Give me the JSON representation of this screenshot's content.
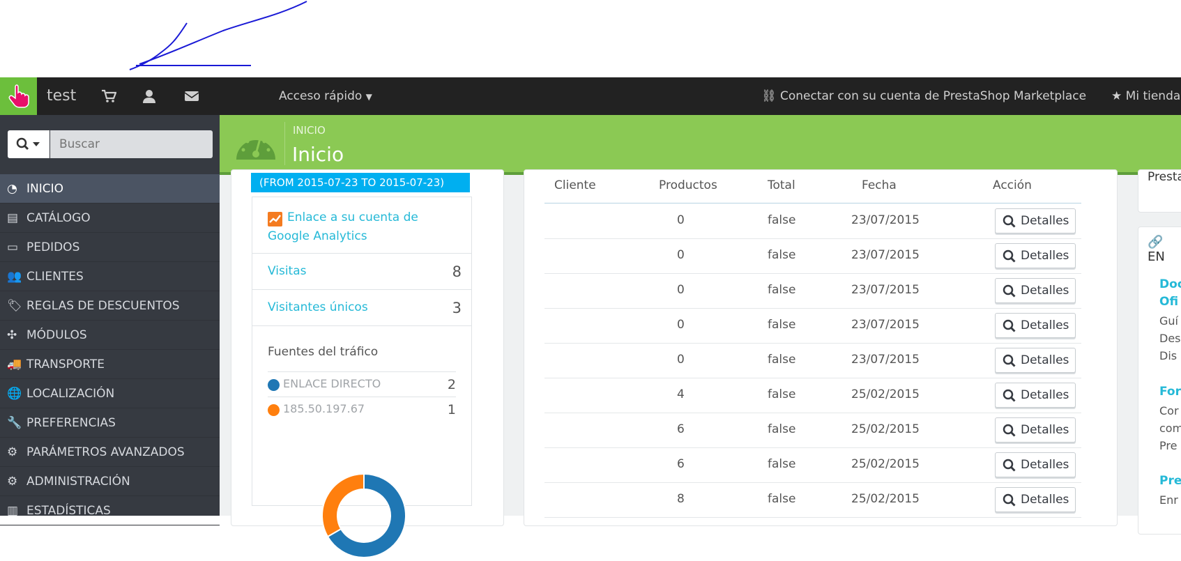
{
  "header": {
    "shop_name": "test",
    "quick_access": "Acceso rápido",
    "marketplace": "Conectar con su cuenta de PrestaShop Marketplace",
    "my_store": "Mi tienda",
    "icons": [
      "cart-icon",
      "user-icon",
      "envelope-icon"
    ],
    "accent": "#6cbf3c"
  },
  "search": {
    "placeholder": "Buscar"
  },
  "sidebar": {
    "items": [
      {
        "label": "INICIO",
        "icon": "dashboard-icon",
        "active": true
      },
      {
        "label": "CATÁLOGO",
        "icon": "book-icon"
      },
      {
        "label": "PEDIDOS",
        "icon": "credit-card-icon"
      },
      {
        "label": "CLIENTES",
        "icon": "users-icon"
      },
      {
        "label": "REGLAS DE DESCUENTOS",
        "icon": "tags-icon"
      },
      {
        "label": "MÓDULOS",
        "icon": "puzzle-icon"
      },
      {
        "label": "TRANSPORTE",
        "icon": "truck-icon"
      },
      {
        "label": "LOCALIZACIÓN",
        "icon": "globe-icon"
      },
      {
        "label": "PREFERENCIAS",
        "icon": "wrench-icon"
      },
      {
        "label": "PARÁMETROS AVANZADOS",
        "icon": "cogs-icon"
      },
      {
        "label": "ADMINISTRACIÓN",
        "icon": "cog-icon"
      },
      {
        "label": "ESTADÍSTICAS",
        "icon": "chart-icon"
      }
    ]
  },
  "page": {
    "breadcrumb": "INICIO",
    "title": "Inicio",
    "header_color": "#8bc954"
  },
  "analytics": {
    "date_range": "(FROM 2015-07-23 TO 2015-07-23)",
    "ga_link": "Enlace a su cuenta de Google Analytics",
    "visits_label": "Visitas",
    "visits": "8",
    "unique_label": "Visitantes únicos",
    "unique": "3",
    "traffic_title": "Fuentes del tráfico",
    "sources": [
      {
        "name": "ENLACE DIRECTO",
        "count": "2",
        "color": "#1f77b4"
      },
      {
        "name": "185.50.197.67",
        "count": "1",
        "color": "#ff7f0e"
      }
    ]
  },
  "orders": {
    "headers": [
      "Cliente",
      "Productos",
      "Total",
      "Fecha",
      "Acción"
    ],
    "rows": [
      {
        "client": "",
        "products": "0",
        "total": "false",
        "date": "23/07/2015",
        "action": "Detalles"
      },
      {
        "client": "",
        "products": "0",
        "total": "false",
        "date": "23/07/2015",
        "action": "Detalles"
      },
      {
        "client": "",
        "products": "0",
        "total": "false",
        "date": "23/07/2015",
        "action": "Detalles"
      },
      {
        "client": "",
        "products": "0",
        "total": "false",
        "date": "23/07/2015",
        "action": "Detalles"
      },
      {
        "client": "",
        "products": "0",
        "total": "false",
        "date": "23/07/2015",
        "action": "Detalles"
      },
      {
        "client": "",
        "products": "4",
        "total": "false",
        "date": "25/02/2015",
        "action": "Detalles"
      },
      {
        "client": "",
        "products": "6",
        "total": "false",
        "date": "25/02/2015",
        "action": "Detalles"
      },
      {
        "client": "",
        "products": "6",
        "total": "false",
        "date": "25/02/2015",
        "action": "Detalles"
      },
      {
        "client": "",
        "products": "8",
        "total": "false",
        "date": "25/02/2015",
        "action": "Detalles"
      }
    ]
  },
  "right_panel": {
    "presta_heading": "Presta",
    "links_heading": "EN",
    "sections": [
      {
        "title": "Doc",
        "title2": "Ofi",
        "lines": [
          "Guí",
          "Des",
          "Dis"
        ]
      },
      {
        "title": "For",
        "lines": [
          "Cor",
          "com",
          "Pre"
        ]
      },
      {
        "title": "Pre",
        "lines": [
          "Enr"
        ]
      }
    ]
  }
}
